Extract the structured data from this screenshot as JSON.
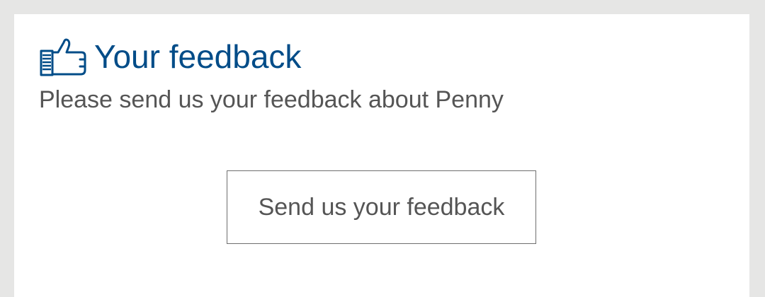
{
  "feedback": {
    "icon": "thumbs-up-icon",
    "title": "Your feedback",
    "description": "Please send us your feedback about Penny",
    "button_label": "Send us your feedback"
  },
  "colors": {
    "title": "#004c88",
    "text": "#555555",
    "page_background": "#e6e6e5",
    "card_background": "#ffffff",
    "button_border": "#6e6e6e"
  }
}
